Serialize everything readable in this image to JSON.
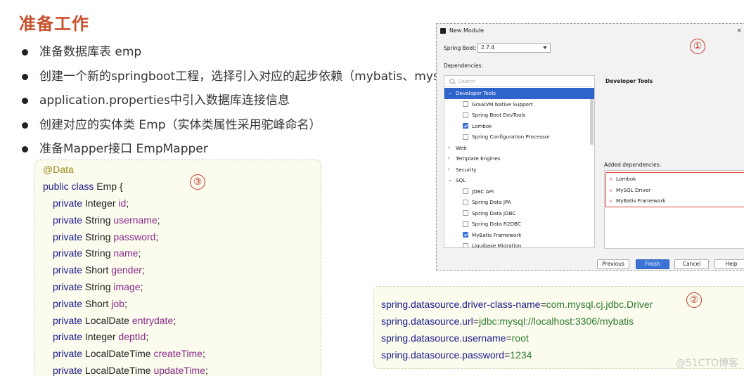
{
  "slide": {
    "title": "准备工作",
    "bullets": [
      "准备数据库表 emp",
      "创建一个新的springboot工程，选择引入对应的起步依赖（mybatis、mysql",
      "application.properties中引入数据库连接信息",
      "创建对应的实体类 Emp（实体类属性采用驼峰命名）",
      "准备Mapper接口 EmpMapper"
    ]
  },
  "code": {
    "annotation": "@Data",
    "class_kw": "public class ",
    "class_name": "Emp {",
    "fields": [
      {
        "mod": "private ",
        "type": "Integer ",
        "name": "id",
        "end": ";"
      },
      {
        "mod": "private ",
        "type": "String ",
        "name": "username",
        "end": ";"
      },
      {
        "mod": "private ",
        "type": "String ",
        "name": "password",
        "end": ";"
      },
      {
        "mod": "private ",
        "type": "String ",
        "name": "name",
        "end": ";"
      },
      {
        "mod": "private ",
        "type": "Short ",
        "name": "gender",
        "end": ";"
      },
      {
        "mod": "private ",
        "type": "String ",
        "name": "image",
        "end": ";"
      },
      {
        "mod": "private ",
        "type": "Short ",
        "name": "job",
        "end": ";"
      },
      {
        "mod": "private ",
        "type": "LocalDate ",
        "name": "entrydate",
        "end": ";"
      },
      {
        "mod": "private ",
        "type": "Integer ",
        "name": "deptId",
        "end": ";"
      },
      {
        "mod": "private ",
        "type": "LocalDateTime ",
        "name": "createTime",
        "end": ";"
      },
      {
        "mod": "private ",
        "type": "LocalDateTime ",
        "name": "updateTime",
        "end": ";"
      }
    ]
  },
  "markers": {
    "one": "①",
    "two": "②",
    "three": "③"
  },
  "properties": [
    {
      "key": "spring.datasource.driver-class-name",
      "eq": "=",
      "value": "com.mysql.cj.jdbc.Driver"
    },
    {
      "key": "spring.datasource.url",
      "eq": "=",
      "value": "jdbc:mysql://localhost:3306/mybatis"
    },
    {
      "key": "spring.datasource.username",
      "eq": "=",
      "value": "root"
    },
    {
      "key": "spring.datasource.password",
      "eq": "=",
      "value": "1234"
    }
  ],
  "dialog": {
    "title": "New Module",
    "close": "×",
    "spring_boot_label": "Spring Boot:",
    "spring_boot_value": "2.7.4",
    "dependencies_label": "Dependencies:",
    "search_placeholder": "Search",
    "tree": [
      {
        "kind": "group",
        "caret": "⌄",
        "label": "Developer Tools",
        "selected": true
      },
      {
        "kind": "item",
        "label": "GraalVM Native Support",
        "checked": false
      },
      {
        "kind": "item",
        "label": "Spring Boot DevTools",
        "checked": false
      },
      {
        "kind": "item",
        "label": "Lombok",
        "checked": true
      },
      {
        "kind": "item",
        "label": "Spring Configuration Processor",
        "checked": false
      },
      {
        "kind": "group",
        "caret": "›",
        "label": "Web",
        "selected": false
      },
      {
        "kind": "group",
        "caret": "›",
        "label": "Template Engines",
        "selected": false
      },
      {
        "kind": "group",
        "caret": "›",
        "label": "Security",
        "selected": false
      },
      {
        "kind": "group",
        "caret": "⌄",
        "label": "SQL",
        "selected": false
      },
      {
        "kind": "item",
        "label": "JDBC API",
        "checked": false
      },
      {
        "kind": "item",
        "label": "Spring Data JPA",
        "checked": false
      },
      {
        "kind": "item",
        "label": "Spring Data JDBC",
        "checked": false
      },
      {
        "kind": "item",
        "label": "Spring Data R2DBC",
        "checked": false
      },
      {
        "kind": "item",
        "label": "MyBatis Framework",
        "checked": true
      },
      {
        "kind": "item",
        "label": "Liquibase Migration",
        "checked": false
      }
    ],
    "detail_title": "Developer Tools",
    "added_label": "Added dependencies:",
    "added": [
      "Lombok",
      "MySQL Driver",
      "MyBatis Framework"
    ],
    "remove_glyph": "×",
    "buttons": {
      "previous": "Previous",
      "finish": "Finish",
      "cancel": "Cancel",
      "help": "Help"
    }
  },
  "watermark": "@51CTO博客"
}
